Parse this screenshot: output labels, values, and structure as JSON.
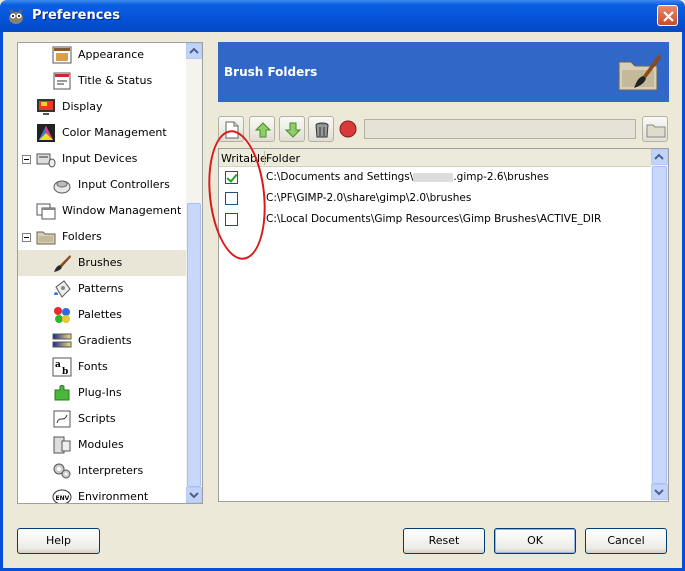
{
  "window": {
    "title": "Preferences"
  },
  "tree": {
    "items": [
      {
        "label": "Appearance",
        "icon": "appearance-icon"
      },
      {
        "label": "Title & Status",
        "icon": "title-status-icon"
      },
      {
        "label": "Display",
        "icon": "display-icon"
      },
      {
        "label": "Color Management",
        "icon": "color-management-icon"
      },
      {
        "label": "Input Devices",
        "icon": "input-devices-icon"
      },
      {
        "label": "Input Controllers",
        "icon": "input-controllers-icon"
      },
      {
        "label": "Window Management",
        "icon": "window-management-icon"
      },
      {
        "label": "Folders",
        "icon": "folders-icon"
      },
      {
        "label": "Brushes",
        "icon": "brushes-icon"
      },
      {
        "label": "Patterns",
        "icon": "patterns-icon"
      },
      {
        "label": "Palettes",
        "icon": "palettes-icon"
      },
      {
        "label": "Gradients",
        "icon": "gradients-icon"
      },
      {
        "label": "Fonts",
        "icon": "fonts-icon"
      },
      {
        "label": "Plug-Ins",
        "icon": "plugins-icon"
      },
      {
        "label": "Scripts",
        "icon": "scripts-icon"
      },
      {
        "label": "Modules",
        "icon": "modules-icon"
      },
      {
        "label": "Interpreters",
        "icon": "interpreters-icon"
      },
      {
        "label": "Environment",
        "icon": "environment-icon"
      }
    ],
    "selected": "Brushes"
  },
  "panel": {
    "title": "Brush Folders",
    "header_color": "#3168c8"
  },
  "list": {
    "columns": [
      "Writable",
      "Folder"
    ],
    "rows": [
      {
        "writable": true,
        "path_prefix": "C:\\Documents and Settings\\",
        "path_suffix": ".gimp-2.6\\brushes"
      },
      {
        "writable": false,
        "path": "C:\\PF\\GIMP-2.0\\share\\gimp\\2.0\\brushes"
      },
      {
        "writable": false,
        "path": "C:\\Local Documents\\Gimp Resources\\Gimp Brushes\\ACTIVE_DIR"
      }
    ]
  },
  "buttons": {
    "help": "Help",
    "reset": "Reset",
    "ok": "OK",
    "cancel": "Cancel"
  },
  "annotation_color": "#d91a1a"
}
